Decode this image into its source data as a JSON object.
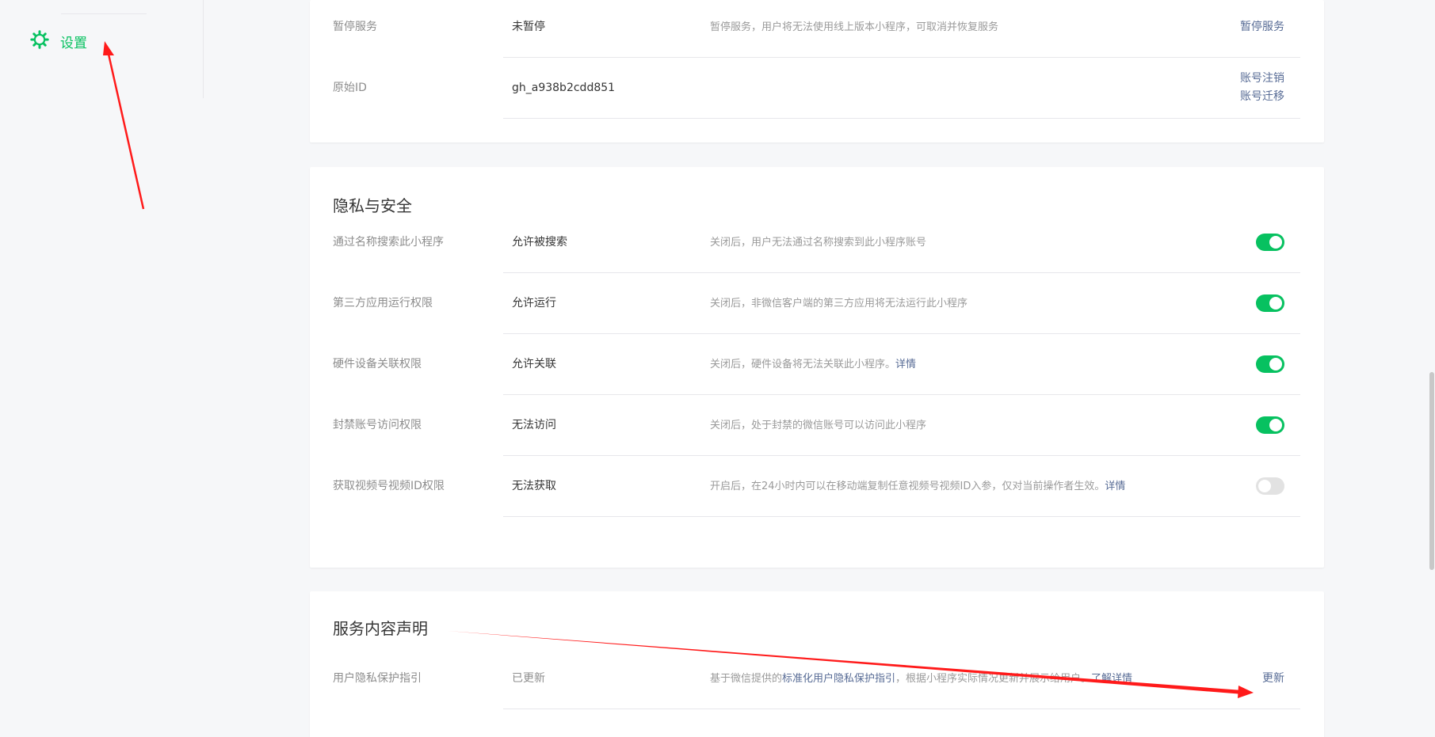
{
  "sidebar": {
    "nav_item": {
      "label": "设置",
      "icon": "gear-icon",
      "color": "#07c160"
    }
  },
  "account_card": {
    "rows": [
      {
        "label": "暂停服务",
        "value": "未暂停",
        "desc": "暂停服务，用户将无法使用线上版本小程序，可取消并恢复服务",
        "action": "暂停服务"
      },
      {
        "label": "原始ID",
        "value": "gh_a938b2cdd851",
        "actions": [
          "账号注销",
          "账号迁移"
        ]
      }
    ]
  },
  "privacy_card": {
    "title": "隐私与安全",
    "rows": [
      {
        "label": "通过名称搜索此小程序",
        "value": "允许被搜索",
        "desc": "关闭后，用户无法通过名称搜索到此小程序账号",
        "toggle_on": true
      },
      {
        "label": "第三方应用运行权限",
        "value": "允许运行",
        "desc": "关闭后，非微信客户端的第三方应用将无法运行此小程序",
        "toggle_on": true
      },
      {
        "label": "硬件设备关联权限",
        "value": "允许关联",
        "desc": "关闭后，硬件设备将无法关联此小程序。",
        "desc_link": "详情",
        "toggle_on": true
      },
      {
        "label": "封禁账号访问权限",
        "value": "无法访问",
        "desc": "关闭后，处于封禁的微信账号可以访问此小程序",
        "toggle_on": true
      },
      {
        "label": "获取视频号视频ID权限",
        "value": "无法获取",
        "desc": "开启后，在24小时内可以在移动端复制任意视频号视频ID入参，仅对当前操作者生效。",
        "desc_link": "详情",
        "toggle_on": false
      }
    ]
  },
  "service_card": {
    "title": "服务内容声明",
    "rows": [
      {
        "label": "用户隐私保护指引",
        "value": "已更新",
        "desc_prefix": "基于微信提供的",
        "desc_link1": "标准化用户隐私保护指引",
        "desc_mid": "，根据小程序实际情况更新并展示给用户。",
        "desc_link2": "了解详情",
        "action": "更新"
      }
    ]
  },
  "colors": {
    "accent_green": "#07c160",
    "link_blue": "#576b95",
    "annotation_red": "#ff1a1a"
  }
}
